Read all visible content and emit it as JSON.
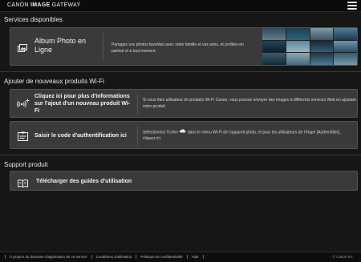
{
  "header": {
    "brand_part1": "CANON ",
    "brand_part2": "IMAGE",
    "brand_part3": " GATEWAY"
  },
  "sections": {
    "services": {
      "title": "Services disponibles",
      "album": {
        "label": "Album Photo en Ligne",
        "description": "Partagez vos photos favorites avec votre famille et vos amis, et profitez-en partout et à tout moment."
      }
    },
    "wifi": {
      "title": "Ajouter de nouveaux produits Wi-Fi",
      "info_card": {
        "label": "Cliquez ici pour plus d'informations sur l'ajout d'un nouveau produit Wi-Fi",
        "description": "Si vous êtes utilisateur de produits Wi-Fi Canon, vous pouvez envoyer des images à différents services Web en ajoutant votre produit."
      },
      "auth_card": {
        "label": "Saisir le code d'authentification ici",
        "description_before": "Sélectionnez l'icône",
        "description_after": "dans le menu Wi-Fi de l'appareil photo, et pour les utilisateurs de l'étape [Authentifier], cliquez ici."
      }
    },
    "support": {
      "title": "Support produit",
      "guides_card": {
        "label": "Télécharger des guides d'utilisation"
      }
    }
  },
  "footer": {
    "links": [
      "À propos du domaine d'application de ce service",
      "Conditions d'utilisation",
      "Politique de confidentialité",
      "Aide"
    ],
    "copyright": "© Canon Inc."
  },
  "icons": {
    "album": "photo-album-icon",
    "wifi_add": "wifi-plus-icon",
    "auth_code": "id-card-icon",
    "cloud": "cloud-icon",
    "manual": "open-book-icon",
    "menu": "hamburger-menu-icon"
  },
  "colors": {
    "background": "#161616",
    "card": "#3a3a3a",
    "card_border": "#525252",
    "text": "#e6e6e6"
  }
}
